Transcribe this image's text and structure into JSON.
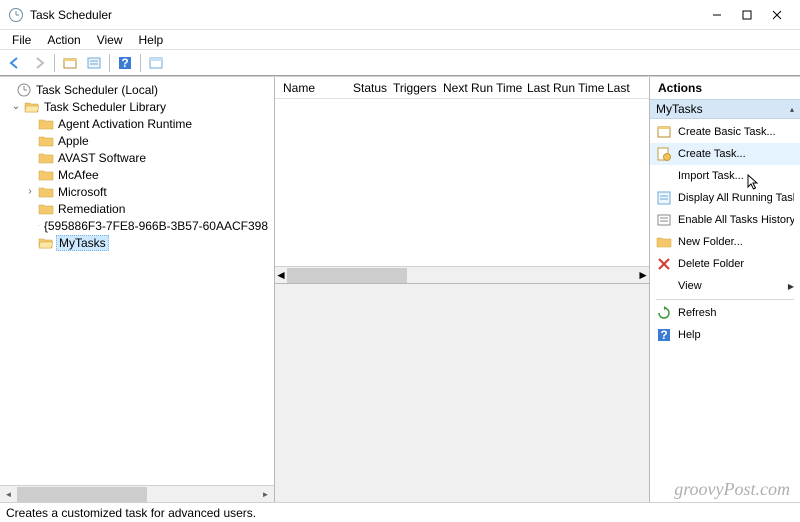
{
  "title": "Task Scheduler",
  "menubar": [
    "File",
    "Action",
    "View",
    "Help"
  ],
  "tree": {
    "root": "Task Scheduler (Local)",
    "library": "Task Scheduler Library",
    "items": [
      "Agent Activation Runtime",
      "Apple",
      "AVAST Software",
      "McAfee",
      "Microsoft",
      "Remediation",
      "{595886F3-7FE8-966B-3B57-60AACF398",
      "MyTasks"
    ]
  },
  "columns": [
    "Name",
    "Status",
    "Triggers",
    "Next Run Time",
    "Last Run Time",
    "Last"
  ],
  "actions": {
    "title": "Actions",
    "section": "MyTasks",
    "items": [
      {
        "icon": "basic-task",
        "label": "Create Basic Task..."
      },
      {
        "icon": "task",
        "label": "Create Task..."
      },
      {
        "icon": "none",
        "label": "Import Task..."
      },
      {
        "icon": "display",
        "label": "Display All Running Tasks"
      },
      {
        "icon": "history",
        "label": "Enable All Tasks History"
      },
      {
        "icon": "folder",
        "label": "New Folder..."
      },
      {
        "icon": "delete",
        "label": "Delete Folder"
      },
      {
        "icon": "none",
        "label": "View",
        "submenu": true
      },
      {
        "icon": "refresh",
        "label": "Refresh",
        "sep_before": true
      },
      {
        "icon": "help",
        "label": "Help"
      }
    ]
  },
  "statusbar": "Creates a customized task for advanced users.",
  "watermark": "groovyPost.com"
}
